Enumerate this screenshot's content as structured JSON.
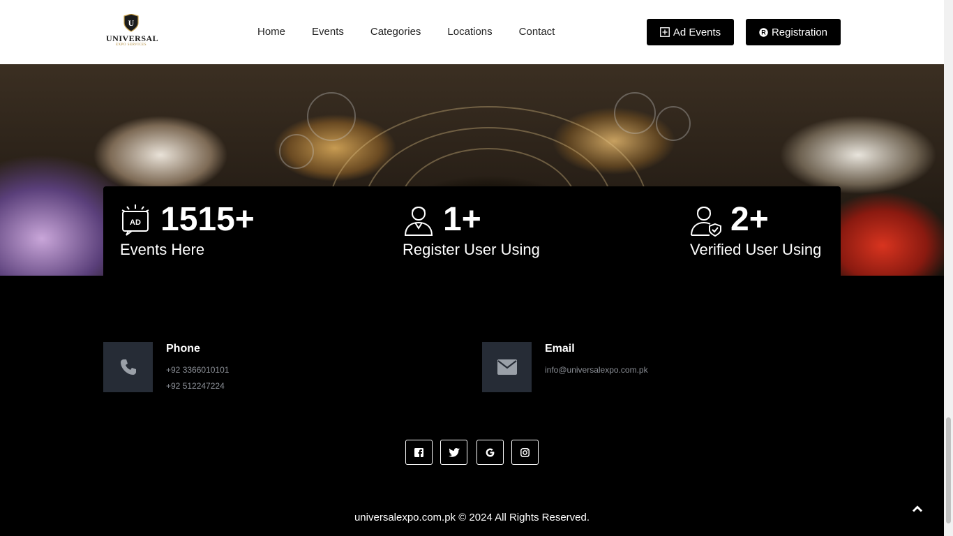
{
  "header": {
    "logo": {
      "brand": "UNIVERSAL",
      "sub": "EXPO SERVICES",
      "crest_letter": "U"
    },
    "nav": [
      {
        "label": "Home"
      },
      {
        "label": "Events"
      },
      {
        "label": "Categories"
      },
      {
        "label": "Locations"
      },
      {
        "label": "Contact"
      }
    ],
    "ad_events_label": "Ad Events",
    "registration_label": "Registration"
  },
  "stats": [
    {
      "value": "1515+",
      "label": "Events Here",
      "icon": "ad-icon"
    },
    {
      "value": "1+",
      "label": "Register User Using",
      "icon": "user-icon"
    },
    {
      "value": "2+",
      "label": "Verified User Using",
      "icon": "verified-user-icon"
    }
  ],
  "contact": {
    "phone": {
      "title": "Phone",
      "values": [
        "+92 3366010101",
        "+92 512247224"
      ],
      "icon": "phone-icon"
    },
    "email": {
      "title": "Email",
      "values": [
        "info@universalexpo.com.pk"
      ],
      "icon": "envelope-icon"
    }
  },
  "social": [
    {
      "name": "facebook-icon"
    },
    {
      "name": "twitter-icon"
    },
    {
      "name": "google-icon"
    },
    {
      "name": "instagram-icon"
    }
  ],
  "footer": {
    "copyright": "universalexpo.com.pk © 2024 All Rights Reserved."
  },
  "colors": {
    "accent": "#000000",
    "contact_box": "#262c36",
    "muted_text": "#8b8f96"
  }
}
